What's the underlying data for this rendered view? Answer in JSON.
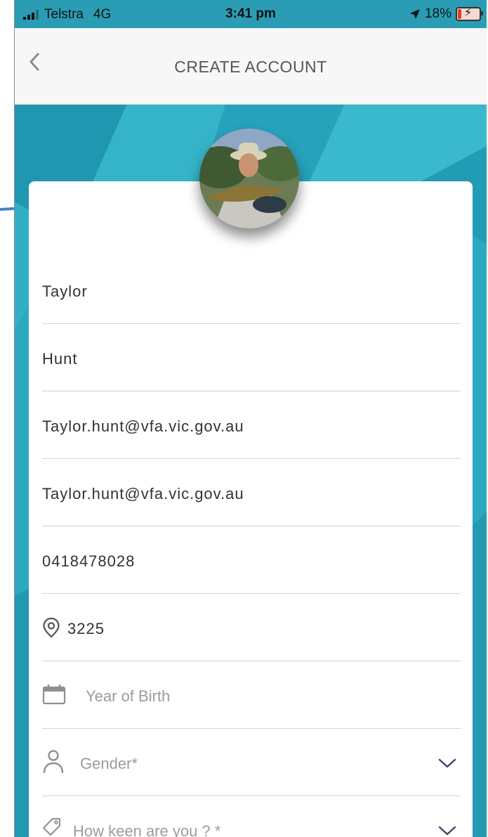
{
  "status_bar": {
    "carrier": "Telstra",
    "network": "4G",
    "time": "3:41 pm",
    "battery": "18%",
    "battery_level": 0.18,
    "icons": [
      "signal-bars-icon",
      "location-arrow-icon",
      "battery-charging-icon"
    ]
  },
  "nav": {
    "back_icon": "chevron-left-icon",
    "title": "CREATE ACCOUNT"
  },
  "profile": {
    "avatar": "profile-photo"
  },
  "form": {
    "first_name": "Taylor",
    "last_name": "Hunt",
    "email": "Taylor.hunt@vfa.vic.gov.au",
    "confirm_email": "Taylor.hunt@vfa.vic.gov.au",
    "phone": "0418478028",
    "postcode": "3225",
    "year_of_birth_placeholder": "Year of Birth",
    "gender_placeholder": "Gender*",
    "keenness_placeholder": "How keen are you ? *"
  },
  "colors": {
    "teal_bg": "#2aa9c0",
    "nav_bg": "#f7f7f7",
    "card_bg": "#ffffff",
    "arrow": "#4a7fc4",
    "icon_gray": "#9a9a9a"
  }
}
